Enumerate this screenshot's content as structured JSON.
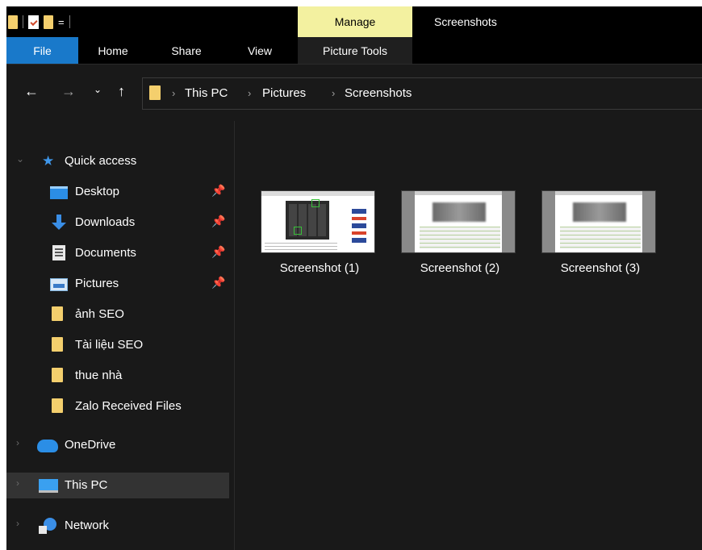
{
  "window": {
    "title": "Screenshots",
    "manage_tab": "Manage",
    "qat_menu_glyph": "="
  },
  "ribbon": {
    "tabs": [
      "File",
      "Home",
      "Share",
      "View",
      "Picture Tools"
    ]
  },
  "address": {
    "back": "←",
    "forward": "→",
    "recent": "⌄",
    "up": "↑",
    "separator": "›",
    "crumbs": [
      "This PC",
      "Pictures",
      "Screenshots"
    ]
  },
  "nav": {
    "expand_glyph": "⌄",
    "collapsed_glyph": "›",
    "pin_glyph": "📌",
    "quick_access": "Quick access",
    "items": [
      {
        "label": "Desktop",
        "icon": "desktop-icon",
        "pinned": true
      },
      {
        "label": "Downloads",
        "icon": "downloads-icon",
        "pinned": true
      },
      {
        "label": "Documents",
        "icon": "documents-icon",
        "pinned": true
      },
      {
        "label": "Pictures",
        "icon": "pictures-icon",
        "pinned": true
      },
      {
        "label": "ảnh SEO",
        "icon": "folder-icon",
        "pinned": false
      },
      {
        "label": "Tài liệu SEO",
        "icon": "folder-icon",
        "pinned": false
      },
      {
        "label": "thue nhà",
        "icon": "folder-icon",
        "pinned": false
      },
      {
        "label": "Zalo Received Files",
        "icon": "folder-icon",
        "pinned": false
      }
    ],
    "onedrive": "OneDrive",
    "this_pc": "This PC",
    "network": "Network"
  },
  "files": [
    {
      "name": "Screenshot (1)"
    },
    {
      "name": "Screenshot (2)"
    },
    {
      "name": "Screenshot (3)"
    }
  ],
  "colors": {
    "file_tab": "#1979ca",
    "manage_tab": "#f3f1a0",
    "folder": "#f4cf6d",
    "selected_nav": "#333333",
    "background": "#191919"
  }
}
